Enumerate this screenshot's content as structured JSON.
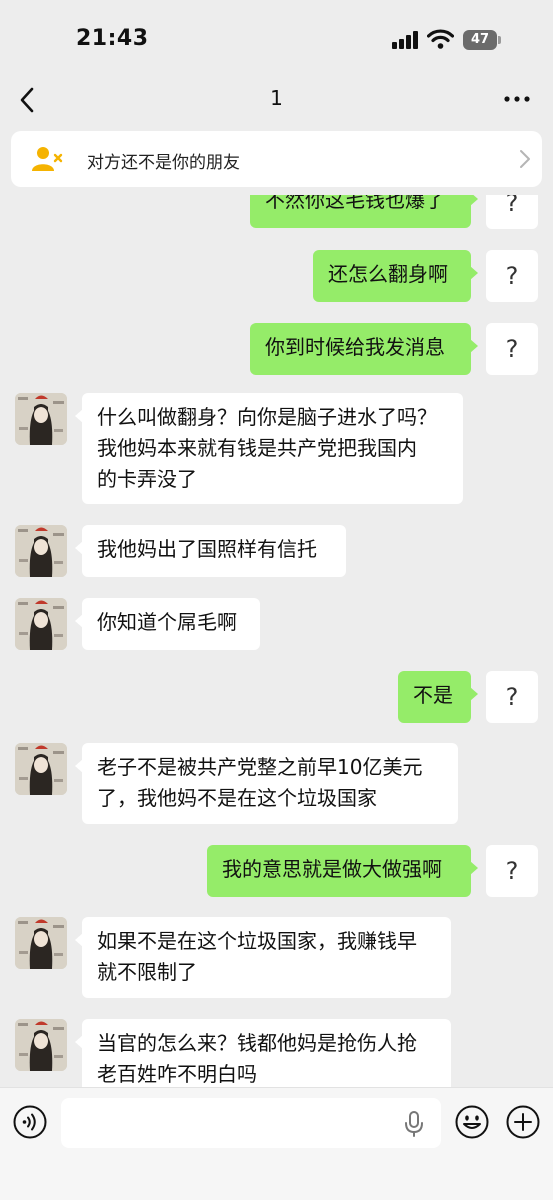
{
  "status_bar": {
    "time": "21:43",
    "battery": "47"
  },
  "nav": {
    "title": "1"
  },
  "friend_notice": {
    "text": "对方还不是你的朋友"
  },
  "messages": [
    {
      "side": "out",
      "lines": [
        "不然你这毛钱也爆了"
      ],
      "status": "?"
    },
    {
      "side": "out",
      "lines": [
        "还怎么翻身啊"
      ],
      "status": "?"
    },
    {
      "side": "out",
      "lines": [
        "你到时候给我发消息"
      ],
      "status": "?"
    },
    {
      "side": "in",
      "lines": [
        "什么叫做翻身？向你是脑子进水了吗？",
        "我他妈本来就有钱是共产党把我国内",
        "的卡弄没了"
      ]
    },
    {
      "side": "in",
      "lines": [
        "我他妈出了国照样有信托"
      ]
    },
    {
      "side": "in",
      "lines": [
        "你知道个屌毛啊"
      ]
    },
    {
      "side": "out",
      "lines": [
        "不是"
      ],
      "status": "?"
    },
    {
      "side": "in",
      "lines": [
        "老子不是被共产党整之前早10亿美元",
        "了，我他妈不是在这个垃圾国家"
      ]
    },
    {
      "side": "out",
      "lines": [
        "我的意思就是做大做强啊"
      ],
      "status": "?"
    },
    {
      "side": "in",
      "lines": [
        "如果不是在这个垃圾国家，我赚钱早",
        "就不限制了"
      ]
    },
    {
      "side": "in",
      "lines": [
        "当官的怎么来？钱都他妈是抢伤人抢",
        "老百姓咋不明白吗"
      ]
    }
  ],
  "input": {
    "placeholder": ""
  },
  "icons": {
    "back": "chevron-left-icon",
    "more": "more-dots-icon",
    "friend": "person-x-icon",
    "voice": "voice-icon",
    "mic": "microphone-icon",
    "emoji": "emoji-icon",
    "add": "plus-circle-icon"
  },
  "colors": {
    "background": "#ededed",
    "bubble_out": "#95ec69",
    "bubble_in": "#ffffff",
    "notice_icon": "#f5b301"
  }
}
